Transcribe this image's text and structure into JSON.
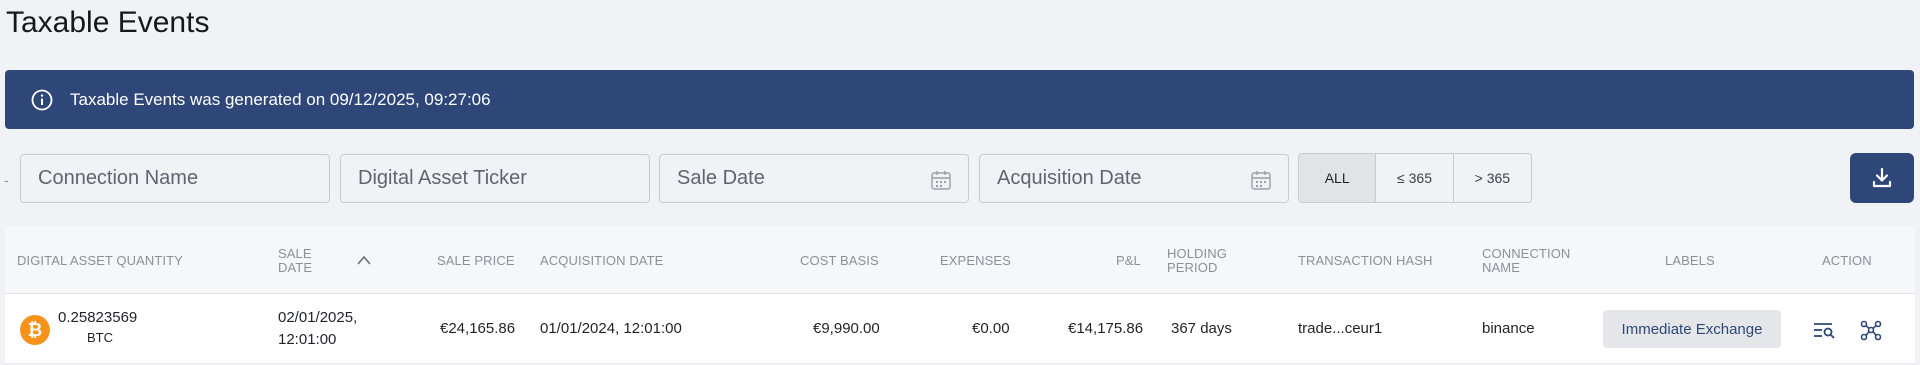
{
  "page": {
    "title": "Taxable Events"
  },
  "banner": {
    "message": "Taxable Events was generated on 09/12/2025, 09:27:06",
    "icon": "info-icon"
  },
  "filters": {
    "dash": "-",
    "connection_name_placeholder": "Connection Name",
    "ticker_placeholder": "Digital Asset Ticker",
    "sale_date_placeholder": "Sale Date",
    "acquisition_date_placeholder": "Acquisition Date",
    "holding_options": [
      "ALL",
      "≤ 365",
      "> 365"
    ],
    "selected_holding": "ALL"
  },
  "download": {
    "icon": "download-icon"
  },
  "table": {
    "columns": {
      "quantity": "Digital Asset Quantity",
      "sale_date": "Sale Date",
      "sale_price": "Sale Price",
      "acquisition_date": "Acquisition Date",
      "cost_basis": "Cost Basis",
      "expenses": "Expenses",
      "pnl": "P&L",
      "holding_period": "Holding Period",
      "tx_hash": "Transaction Hash",
      "connection_name": "Connection Name",
      "labels": "Labels",
      "action": "Action"
    },
    "sort": {
      "column": "sale_date",
      "direction": "ascending"
    },
    "rows": [
      {
        "coin_icon": "bitcoin-icon",
        "coin_symbol": "₿",
        "quantity": "0.25823569",
        "ticker": "BTC",
        "sale_date_line1": "02/01/2025,",
        "sale_date_line2": "12:01:00",
        "sale_price": "€24,165.86",
        "acquisition_date": "01/01/2024, 12:01:00",
        "cost_basis": "€9,990.00",
        "expenses": "€0.00",
        "pnl": "€14,175.86",
        "holding_period": "367 days",
        "tx_hash": "trade...ceur1",
        "connection_name": "binance",
        "label": "Immediate Exchange"
      }
    ]
  },
  "colors": {
    "primary": "#2e4778",
    "bitcoin": "#f7931a",
    "background": "#f1f2f5"
  }
}
